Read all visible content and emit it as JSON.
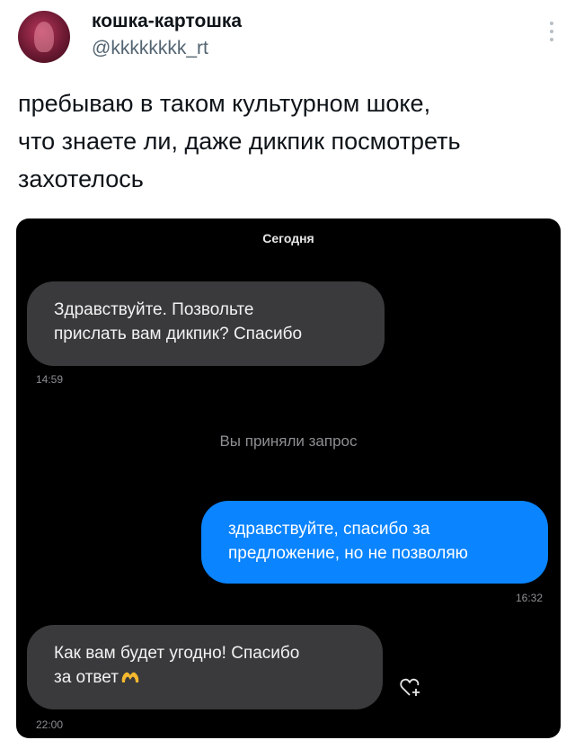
{
  "tweet": {
    "display_name": "кошка-картошка",
    "handle": "@kkkkkkkk_rt",
    "text": "пребываю в таком культурном шоке,\nчто знаете ли, даже дикпик посмотреть\nзахотелось"
  },
  "chat": {
    "date_label": "Сегодня",
    "system_message": "Вы приняли запрос",
    "messages": [
      {
        "direction": "incoming",
        "text": "Здравствуйте. Позвольте\nприслать вам дикпик? Спасибо",
        "time": "14:59"
      },
      {
        "direction": "outgoing",
        "text": "здравствуйте, спасибо за\nпредложение, но не позволяю",
        "time": "16:32"
      },
      {
        "direction": "incoming",
        "text": "Как вам будет угодно! Спасибо\nза ответ",
        "emoji": "hand-heart-emoji",
        "time": "22:00"
      }
    ]
  },
  "colors": {
    "chat_background": "#000000",
    "incoming_bubble": "#3a3a3c",
    "outgoing_bubble": "#0a84ff",
    "handle_text": "#536471"
  }
}
